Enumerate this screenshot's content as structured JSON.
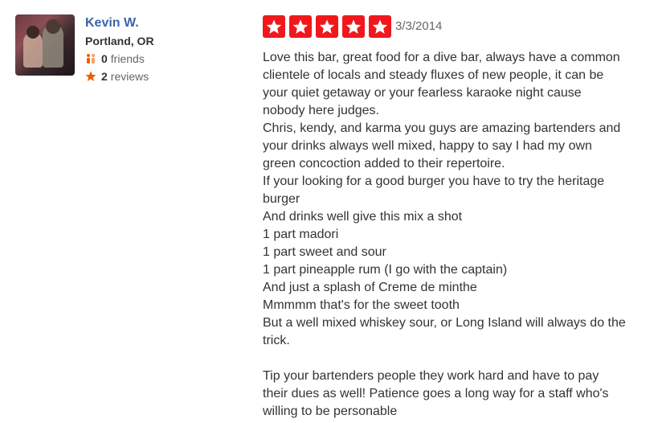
{
  "user": {
    "name": "Kevin W.",
    "location": "Portland, OR",
    "friends_count": "0",
    "friends_label": "friends",
    "reviews_count": "2",
    "reviews_label": "reviews"
  },
  "review": {
    "rating": 5,
    "rating_max": 5,
    "star_color": "#f0181c",
    "date": "3/3/2014",
    "lines": [
      "Love this bar, great food for a dive bar, always have a common",
      "clientele of locals and steady fluxes of new people, it can be",
      "your quiet getaway or your fearless karaoke night cause",
      "nobody here judges.",
      "Chris, kendy, and karma you guys are amazing bartenders and",
      "your drinks always well mixed, happy to say I had my own",
      "green concoction added to their repertoire.",
      "If your looking for a good burger you have to try the heritage",
      "burger",
      "And drinks well give this mix a shot",
      "1 part madori",
      "1 part sweet and sour",
      "1 part pineapple rum (I go with the captain)",
      "And just a splash of Creme de minthe",
      "Mmmmm that's for the sweet tooth",
      "But a well mixed whiskey sour, or Long Island will always do the",
      "trick.",
      "",
      "Tip your bartenders people they work hard and have to pay",
      "their dues as well! Patience goes a long way for a staff who's",
      "willing to be personable"
    ]
  },
  "icons": {
    "friends": "friends-icon",
    "reviews": "star-icon",
    "friends_icon_color": "#f15c00",
    "reviews_icon_color": "#f15c00"
  }
}
